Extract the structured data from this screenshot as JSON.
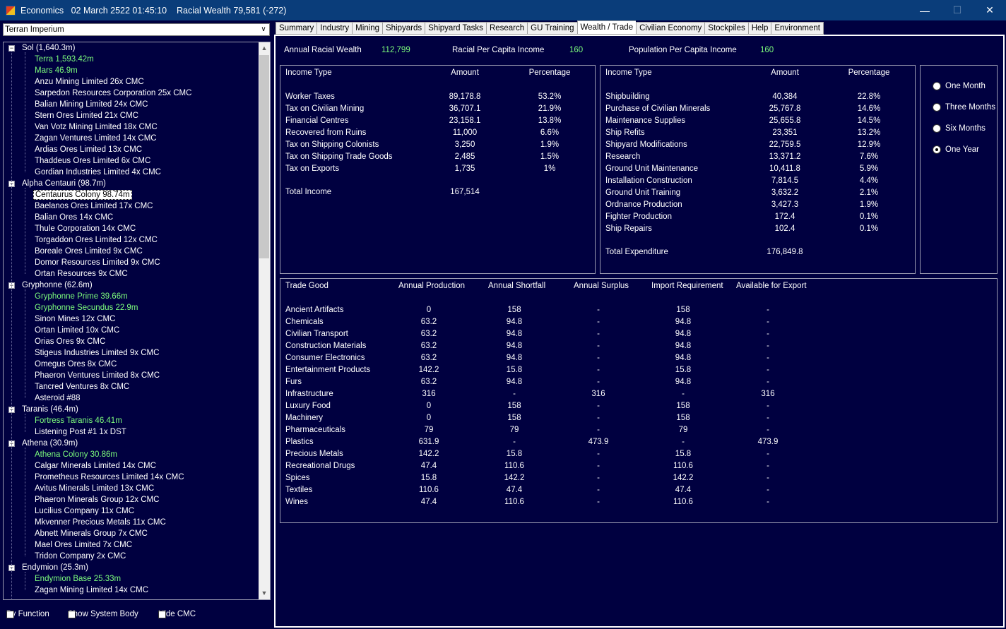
{
  "window": {
    "app_name": "Economics",
    "datetime": "02 March 2522 01:45:10",
    "wealth_label": "Racial Wealth 79,581 (-272)",
    "minimize": "—",
    "maximize": "☐",
    "close": "✕"
  },
  "empire_select": {
    "value": "Terran Imperium",
    "arrow": "∨"
  },
  "tree": [
    {
      "type": "system",
      "label": "Sol  (1,640.3m)",
      "expanded": true
    },
    {
      "type": "body",
      "label": "Terra  1,593.42m",
      "pop": true
    },
    {
      "type": "body",
      "label": "Mars  46.9m",
      "pop": true
    },
    {
      "type": "body",
      "label": "Anzu Mining Limited  26x CMC"
    },
    {
      "type": "body",
      "label": "Sarpedon Resources Corporation  25x CMC"
    },
    {
      "type": "body",
      "label": "Balian Mining Limited  24x CMC"
    },
    {
      "type": "body",
      "label": "Stern Ores Limited  21x CMC"
    },
    {
      "type": "body",
      "label": "Van Votz Mining Limited  18x CMC"
    },
    {
      "type": "body",
      "label": "Zagan Ventures Limited  14x CMC"
    },
    {
      "type": "body",
      "label": "Ardias Ores Limited  13x CMC"
    },
    {
      "type": "body",
      "label": "Thaddeus Ores Limited  6x CMC"
    },
    {
      "type": "body",
      "label": "Gordian Industries Limited  4x CMC"
    },
    {
      "type": "system",
      "label": "Alpha Centauri  (98.7m)",
      "expanded": true
    },
    {
      "type": "body",
      "label": "Centaurus Colony  98.74m",
      "selected": true
    },
    {
      "type": "body",
      "label": "Baelanos Ores Limited  17x CMC"
    },
    {
      "type": "body",
      "label": "Balian Ores  14x CMC"
    },
    {
      "type": "body",
      "label": "Thule Corporation  14x CMC"
    },
    {
      "type": "body",
      "label": "Torgaddon Ores Limited  12x CMC"
    },
    {
      "type": "body",
      "label": "Boreale Ores Limited  9x CMC"
    },
    {
      "type": "body",
      "label": "Domor Resources Limited  9x CMC"
    },
    {
      "type": "body",
      "label": "Ortan Resources  9x CMC"
    },
    {
      "type": "system",
      "label": "Gryphonne  (62.6m)",
      "expanded": true
    },
    {
      "type": "body",
      "label": "Gryphonne Prime  39.66m",
      "pop": true
    },
    {
      "type": "body",
      "label": "Gryphonne Secundus  22.9m",
      "pop": true
    },
    {
      "type": "body",
      "label": "Sinon Mines  12x CMC"
    },
    {
      "type": "body",
      "label": "Ortan Limited  10x CMC"
    },
    {
      "type": "body",
      "label": "Orias Ores  9x CMC"
    },
    {
      "type": "body",
      "label": "Stigeus Industries Limited  9x CMC"
    },
    {
      "type": "body",
      "label": "Omegus Ores  8x CMC"
    },
    {
      "type": "body",
      "label": "Phaeron Ventures Limited  8x CMC"
    },
    {
      "type": "body",
      "label": "Tancred Ventures  8x CMC"
    },
    {
      "type": "body",
      "label": "Asteroid #88"
    },
    {
      "type": "system",
      "label": "Taranis  (46.4m)",
      "expanded": true
    },
    {
      "type": "body",
      "label": "Fortress Taranis  46.41m",
      "pop": true
    },
    {
      "type": "body",
      "label": "Listening Post #1  1x DST"
    },
    {
      "type": "system",
      "label": "Athena  (30.9m)",
      "expanded": true
    },
    {
      "type": "body",
      "label": "Athena Colony  30.86m",
      "pop": true
    },
    {
      "type": "body",
      "label": "Calgar Minerals Limited  14x CMC"
    },
    {
      "type": "body",
      "label": "Prometheus Resources Limited  14x CMC"
    },
    {
      "type": "body",
      "label": "Avitus Minerals Limited  13x CMC"
    },
    {
      "type": "body",
      "label": "Phaeron Minerals Group  12x CMC"
    },
    {
      "type": "body",
      "label": "Lucilius Company  11x CMC"
    },
    {
      "type": "body",
      "label": "Mkvenner Precious Metals  11x CMC"
    },
    {
      "type": "body",
      "label": "Abnett Minerals Group  7x CMC"
    },
    {
      "type": "body",
      "label": "Mael Ores Limited  7x CMC"
    },
    {
      "type": "body",
      "label": "Tridon Company  2x CMC"
    },
    {
      "type": "system",
      "label": "Endymion  (25.3m)",
      "expanded": true
    },
    {
      "type": "body",
      "label": "Endymion Base  25.33m",
      "pop": true
    },
    {
      "type": "body",
      "label": "Zagan Mining Limited  14x CMC"
    }
  ],
  "tree_glyphs": {
    "expanded": "−",
    "scroll_up": "▲",
    "scroll_down": "▼"
  },
  "checkboxes": {
    "by_function": "By Function",
    "show_system_body": "Show System Body",
    "hide_cmc": "Hide CMC"
  },
  "tabs": [
    "Summary",
    "Industry",
    "Mining",
    "Shipyards",
    "Shipyard Tasks",
    "Research",
    "GU Training",
    "Wealth / Trade",
    "Civilian Economy",
    "Stockpiles",
    "Help",
    "Environment"
  ],
  "active_tab": 7,
  "summary": {
    "annual_label": "Annual Racial Wealth",
    "annual_value": "112,799",
    "racial_pc_label": "Racial Per Capita Income",
    "racial_pc_value": "160",
    "pop_pc_label": "Population Per Capita Income",
    "pop_pc_value": "160"
  },
  "income": {
    "headers": [
      "Income Type",
      "Amount",
      "Percentage"
    ],
    "rows": [
      [
        "Worker Taxes",
        "89,178.8",
        "53.2%"
      ],
      [
        "Tax on Civilian Mining",
        "36,707.1",
        "21.9%"
      ],
      [
        "Financial Centres",
        "23,158.1",
        "13.8%"
      ],
      [
        "Recovered from Ruins",
        "11,000",
        "6.6%"
      ],
      [
        "Tax on Shipping Colonists",
        "3,250",
        "1.9%"
      ],
      [
        "Tax on Shipping Trade Goods",
        "2,485",
        "1.5%"
      ],
      [
        "Tax on Exports",
        "1,735",
        "1%"
      ]
    ],
    "total_label": "Total Income",
    "total_value": "167,514"
  },
  "expenditure": {
    "headers": [
      "Income Type",
      "Amount",
      "Percentage"
    ],
    "rows": [
      [
        "Shipbuilding",
        "40,384",
        "22.8%"
      ],
      [
        "Purchase of Civilian Minerals",
        "25,767.8",
        "14.6%"
      ],
      [
        "Maintenance Supplies",
        "25,655.8",
        "14.5%"
      ],
      [
        "Ship Refits",
        "23,351",
        "13.2%"
      ],
      [
        "Shipyard Modifications",
        "22,759.5",
        "12.9%"
      ],
      [
        "Research",
        "13,371.2",
        "7.6%"
      ],
      [
        "Ground Unit Maintenance",
        "10,411.8",
        "5.9%"
      ],
      [
        "Installation Construction",
        "7,814.5",
        "4.4%"
      ],
      [
        "Ground Unit Training",
        "3,632.2",
        "2.1%"
      ],
      [
        "Ordnance Production",
        "3,427.3",
        "1.9%"
      ],
      [
        "Fighter Production",
        "172.4",
        "0.1%"
      ],
      [
        "Ship Repairs",
        "102.4",
        "0.1%"
      ]
    ],
    "total_label": "Total Expenditure",
    "total_value": "176,849.8"
  },
  "period": {
    "options": [
      "One Month",
      "Three Months",
      "Six Months",
      "One Year"
    ],
    "selected": 3
  },
  "trade": {
    "headers": [
      "Trade Good",
      "Annual Production",
      "Annual Shortfall",
      "Annual Surplus",
      "Import Requirement",
      "Available for Export"
    ],
    "rows": [
      [
        "Ancient Artifacts",
        "0",
        "158",
        "-",
        "158",
        "-"
      ],
      [
        "Chemicals",
        "63.2",
        "94.8",
        "-",
        "94.8",
        "-"
      ],
      [
        "Civilian Transport",
        "63.2",
        "94.8",
        "-",
        "94.8",
        "-"
      ],
      [
        "Construction Materials",
        "63.2",
        "94.8",
        "-",
        "94.8",
        "-"
      ],
      [
        "Consumer Electronics",
        "63.2",
        "94.8",
        "-",
        "94.8",
        "-"
      ],
      [
        "Entertainment Products",
        "142.2",
        "15.8",
        "-",
        "15.8",
        "-"
      ],
      [
        "Furs",
        "63.2",
        "94.8",
        "-",
        "94.8",
        "-"
      ],
      [
        "Infrastructure",
        "316",
        "-",
        "316",
        "-",
        "316"
      ],
      [
        "Luxury Food",
        "0",
        "158",
        "-",
        "158",
        "-"
      ],
      [
        "Machinery",
        "0",
        "158",
        "-",
        "158",
        "-"
      ],
      [
        "Pharmaceuticals",
        "79",
        "79",
        "-",
        "79",
        "-"
      ],
      [
        "Plastics",
        "631.9",
        "-",
        "473.9",
        "-",
        "473.9"
      ],
      [
        "Precious Metals",
        "142.2",
        "15.8",
        "-",
        "15.8",
        "-"
      ],
      [
        "Recreational Drugs",
        "47.4",
        "110.6",
        "-",
        "110.6",
        "-"
      ],
      [
        "Spices",
        "15.8",
        "142.2",
        "-",
        "142.2",
        "-"
      ],
      [
        "Textiles",
        "110.6",
        "47.4",
        "-",
        "47.4",
        "-"
      ],
      [
        "Wines",
        "47.4",
        "110.6",
        "-",
        "110.6",
        "-"
      ]
    ]
  }
}
